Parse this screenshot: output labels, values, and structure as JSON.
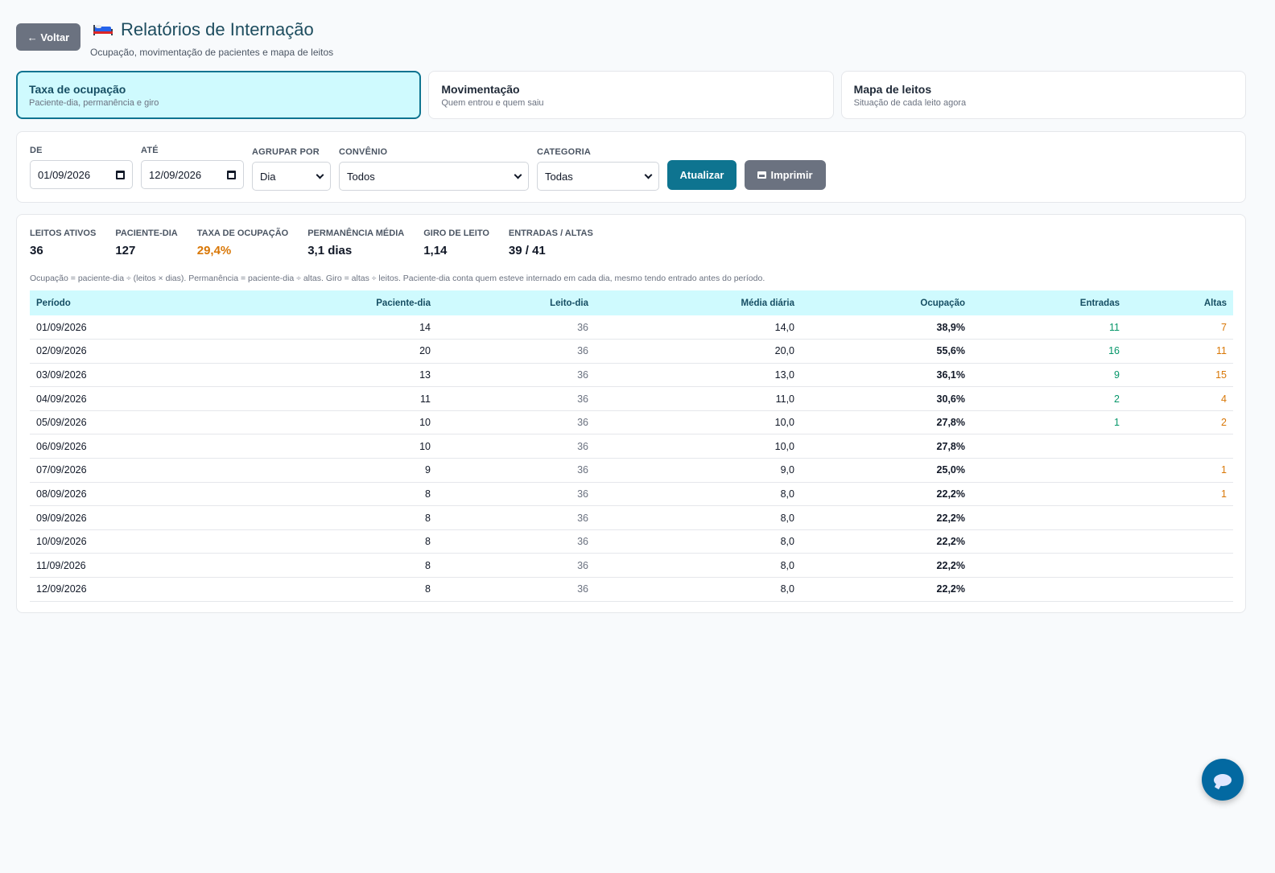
{
  "header": {
    "back_label": "← Voltar",
    "title": "Relatórios de Internação",
    "subtitle": "Ocupação, movimentação de pacientes e mapa de leitos"
  },
  "tabs": [
    {
      "title": "Taxa de ocupação",
      "desc": "Paciente-dia, permanência e giro",
      "active": true
    },
    {
      "title": "Movimentação",
      "desc": "Quem entrou e quem saiu",
      "active": false
    },
    {
      "title": "Mapa de leitos",
      "desc": "Situação de cada leito agora",
      "active": false
    }
  ],
  "filters": {
    "from_label": "DE",
    "from_value": "01/09/2026",
    "to_label": "ATÉ",
    "to_value": "12/09/2026",
    "group_label": "AGRUPAR POR",
    "group_value": "Dia",
    "insurance_label": "CONVÊNIO",
    "insurance_value": "Todos",
    "category_label": "CATEGORIA",
    "category_value": "Todas",
    "update_label": "Atualizar",
    "print_label": "Imprimir"
  },
  "kpis": [
    {
      "label": "LEITOS ATIVOS",
      "value": "36"
    },
    {
      "label": "PACIENTE-DIA",
      "value": "127"
    },
    {
      "label": "TAXA DE OCUPAÇÃO",
      "value": "29,4%"
    },
    {
      "label": "PERMANÊNCIA MÉDIA",
      "value": "3,1 dias"
    },
    {
      "label": "GIRO DE LEITO",
      "value": "1,14"
    },
    {
      "label": "ENTRADAS / ALTAS",
      "value": "39 / 41"
    }
  ],
  "note": "Ocupação = paciente-dia ÷ (leitos × dias). Permanência = paciente-dia ÷ altas. Giro = altas ÷ leitos. Paciente-dia conta quem esteve internado em cada dia, mesmo tendo entrado antes do período.",
  "table": {
    "headers": [
      "Período",
      "Paciente-dia",
      "Leito-dia",
      "Média diária",
      "Ocupação",
      "Entradas",
      "Altas"
    ],
    "rows": [
      [
        "01/09/2026",
        "14",
        "36",
        "14,0",
        "38,9%",
        "11",
        "7"
      ],
      [
        "02/09/2026",
        "20",
        "36",
        "20,0",
        "55,6%",
        "16",
        "11"
      ],
      [
        "03/09/2026",
        "13",
        "36",
        "13,0",
        "36,1%",
        "9",
        "15"
      ],
      [
        "04/09/2026",
        "11",
        "36",
        "11,0",
        "30,6%",
        "2",
        "4"
      ],
      [
        "05/09/2026",
        "10",
        "36",
        "10,0",
        "27,8%",
        "1",
        "2"
      ],
      [
        "06/09/2026",
        "10",
        "36",
        "10,0",
        "27,8%",
        "",
        ""
      ],
      [
        "07/09/2026",
        "9",
        "36",
        "9,0",
        "25,0%",
        "",
        "1"
      ],
      [
        "08/09/2026",
        "8",
        "36",
        "8,0",
        "22,2%",
        "",
        "1"
      ],
      [
        "09/09/2026",
        "8",
        "36",
        "8,0",
        "22,2%",
        "",
        ""
      ],
      [
        "10/09/2026",
        "8",
        "36",
        "8,0",
        "22,2%",
        "",
        ""
      ],
      [
        "11/09/2026",
        "8",
        "36",
        "8,0",
        "22,2%",
        "",
        ""
      ],
      [
        "12/09/2026",
        "8",
        "36",
        "8,0",
        "22,2%",
        "",
        ""
      ]
    ]
  },
  "colors": {
    "accent": "#0e7490",
    "warn": "#d97706",
    "positive": "#059669"
  }
}
